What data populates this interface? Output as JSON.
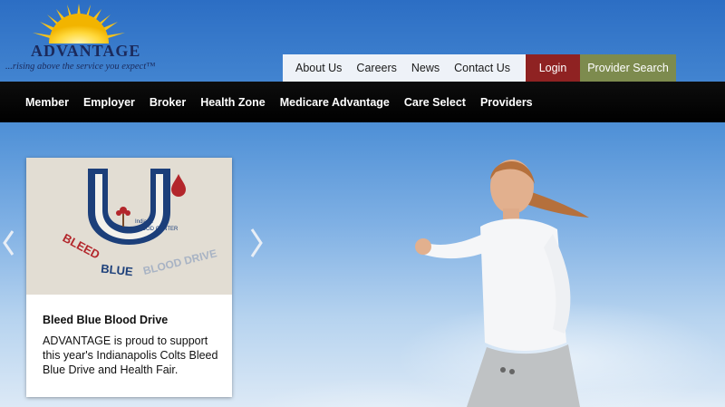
{
  "brand": {
    "name": "ADVANTAGE",
    "tagline": "...rising above the service you expect™"
  },
  "utility_nav": {
    "links": [
      "About Us",
      "Careers",
      "News",
      "Contact Us"
    ],
    "login_label": "Login",
    "provider_search_label": "Provider Search"
  },
  "main_nav": {
    "items": [
      "Member",
      "Employer",
      "Broker",
      "Health Zone",
      "Medicare Advantage",
      "Care Select",
      "Providers"
    ]
  },
  "carousel": {
    "card": {
      "image_lettering": {
        "org": "Indiana BLOOD CENTER",
        "drive": "BLEED BLUE BLOOD DRIVE"
      },
      "title": "Bleed Blue Blood Drive",
      "text": "ADVANTAGE is proud to support this year's Indianapolis Colts Bleed Blue Drive and Health Fair."
    },
    "prev_icon": "chevron-left-icon",
    "next_icon": "chevron-right-icon"
  },
  "colors": {
    "nav_bg": "#000000",
    "login_bg": "#8f2222",
    "provider_bg": "#7d8b4e",
    "colts_blue": "#1c3f7a",
    "blood_red": "#b3262b"
  }
}
